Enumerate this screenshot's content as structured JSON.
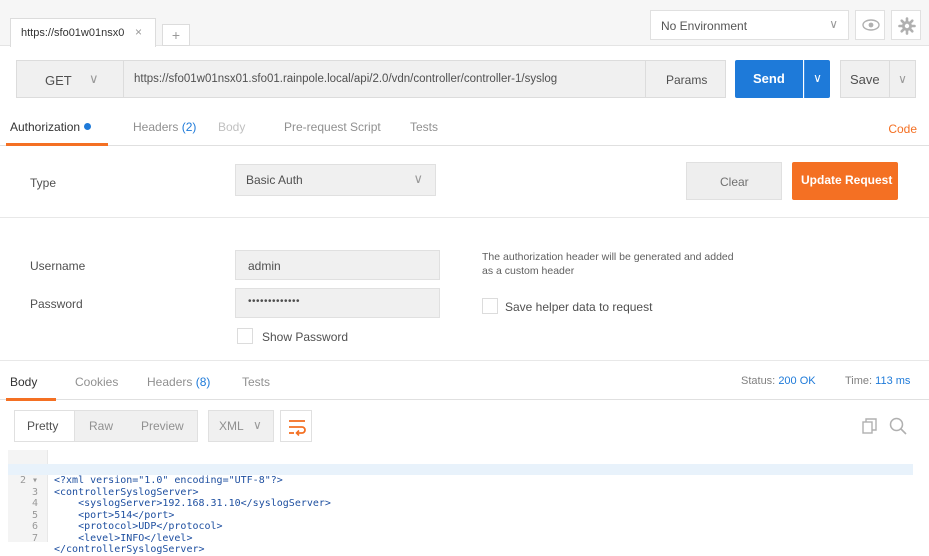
{
  "tabs": [
    {
      "title": "https://sfo01w01nsx0",
      "close_glyph": "×"
    }
  ],
  "tab_add_glyph": "+",
  "environment": {
    "label": "No Environment",
    "caret": "∨"
  },
  "request": {
    "method": "GET",
    "method_caret": "∨",
    "url": "https://sfo01w01nsx01.sfo01.rainpole.local/api/2.0/vdn/controller/controller-1/syslog",
    "params_label": "Params",
    "send_label": "Send",
    "save_label": "Save",
    "caret": "∨"
  },
  "request_tabs": {
    "authorization": "Authorization",
    "headers": "Headers",
    "headers_count": "(2)",
    "body": "Body",
    "pre_request": "Pre-request Script",
    "tests": "Tests",
    "code": "Code"
  },
  "auth": {
    "type_label": "Type",
    "type_value": "Basic Auth",
    "clear_label": "Clear",
    "update_label": "Update Request",
    "username_label": "Username",
    "username_value": "admin",
    "password_label": "Password",
    "password_value": "•••••••••••••",
    "show_password_label": "Show Password",
    "helper_text": "The authorization header will be generated and added as a custom header",
    "save_helper_label": "Save helper data to request"
  },
  "response_tabs": {
    "body": "Body",
    "cookies": "Cookies",
    "headers": "Headers",
    "headers_count": "(8)",
    "tests": "Tests",
    "status_label": "Status:",
    "status_value": "200 OK",
    "time_label": "Time:",
    "time_value": "113 ms"
  },
  "response_toolbar": {
    "pretty": "Pretty",
    "raw": "Raw",
    "preview": "Preview",
    "format": "XML"
  },
  "code_lines": [
    {
      "num": "1",
      "text": "<?xml version=\"1.0\" encoding=\"UTF-8\"?>"
    },
    {
      "num": "2 ▾",
      "text": "<controllerSyslogServer>"
    },
    {
      "num": "3",
      "text": "    <syslogServer>192.168.31.10</syslogServer>"
    },
    {
      "num": "4",
      "text": "    <port>514</port>"
    },
    {
      "num": "5",
      "text": "    <protocol>UDP</protocol>"
    },
    {
      "num": "6",
      "text": "    <level>INFO</level>"
    },
    {
      "num": "7",
      "text": "</controllerSyslogServer>"
    }
  ],
  "colors": {
    "accent": "#f47023",
    "primary": "#1e7ad9"
  }
}
